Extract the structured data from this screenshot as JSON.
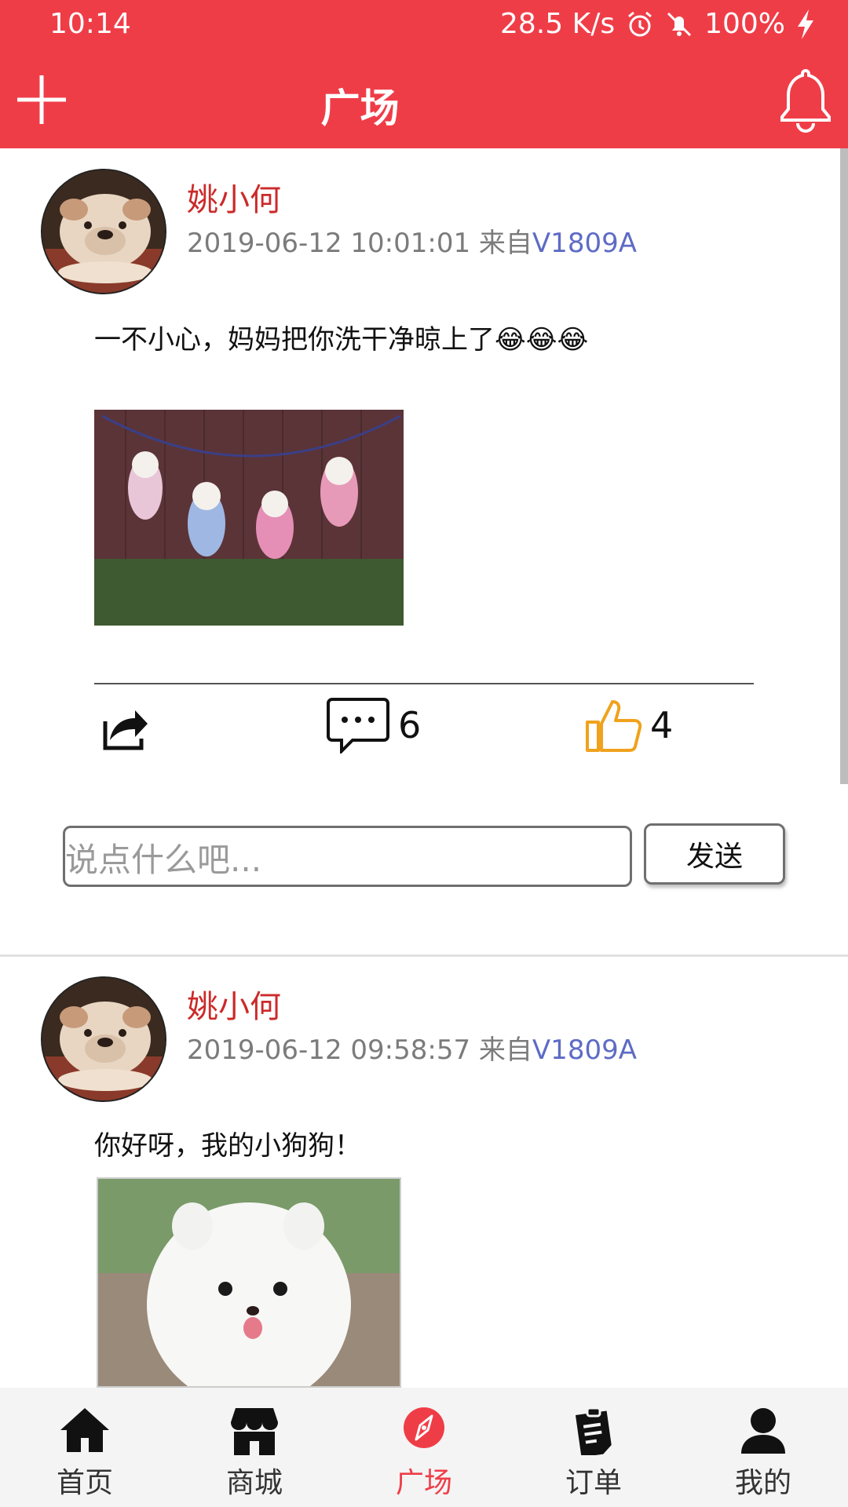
{
  "status_bar": {
    "time": "10:14",
    "speed": "28.5 K/s",
    "battery": "100%"
  },
  "header": {
    "title": "广场"
  },
  "posts": [
    {
      "username": "姚小何",
      "timestamp": "2019-06-12 10:01:01",
      "from_label": "来自",
      "device": "V1809A",
      "text": "一不小心，妈妈把你洗干净晾上了😂😂😂",
      "share_icon": "share-icon",
      "comment_count": "6",
      "like_count": "4",
      "comment_placeholder": "说点什么吧...",
      "send_label": "发送"
    },
    {
      "username": "姚小何",
      "timestamp": "2019-06-12 09:58:57",
      "from_label": "来自",
      "device": "V1809A",
      "text": "你好呀，我的小狗狗！"
    }
  ],
  "bottom_nav": {
    "items": [
      {
        "label": "首页",
        "icon": "home-icon"
      },
      {
        "label": "商城",
        "icon": "store-icon"
      },
      {
        "label": "广场",
        "icon": "compass-icon",
        "active": true
      },
      {
        "label": "订单",
        "icon": "clipboard-icon"
      },
      {
        "label": "我的",
        "icon": "user-icon"
      }
    ]
  },
  "colors": {
    "brand": "#ef3d48",
    "username": "#cc2a2a",
    "device_link": "#5e6bc5",
    "like": "#f0a21d"
  }
}
